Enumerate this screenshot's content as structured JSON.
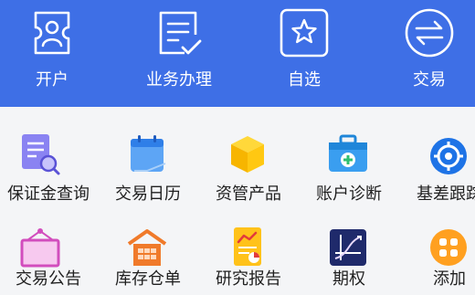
{
  "top_nav": [
    {
      "label": "开户",
      "icon": "id-card-icon"
    },
    {
      "label": "业务办理",
      "icon": "document-check-icon"
    },
    {
      "label": "自选",
      "icon": "star-icon"
    },
    {
      "label": "交易",
      "icon": "exchange-icon"
    }
  ],
  "grid_row1": [
    {
      "label": "保证金查询",
      "icon": "document-search-icon"
    },
    {
      "label": "交易日历",
      "icon": "calendar-icon"
    },
    {
      "label": "资管产品",
      "icon": "cube-icon"
    },
    {
      "label": "账户诊断",
      "icon": "medical-kit-icon"
    },
    {
      "label": "基差跟踪",
      "icon": "target-icon"
    }
  ],
  "grid_row2": [
    {
      "label": "交易公告",
      "icon": "notice-board-icon"
    },
    {
      "label": "库存仓单",
      "icon": "warehouse-icon"
    },
    {
      "label": "研究报告",
      "icon": "report-chart-icon"
    },
    {
      "label": "期权",
      "icon": "option-chart-icon"
    },
    {
      "label": "添加",
      "icon": "add-grid-icon"
    }
  ],
  "colors": {
    "header_bg": "#3e6fe6",
    "page_bg": "#f4f5f7"
  }
}
